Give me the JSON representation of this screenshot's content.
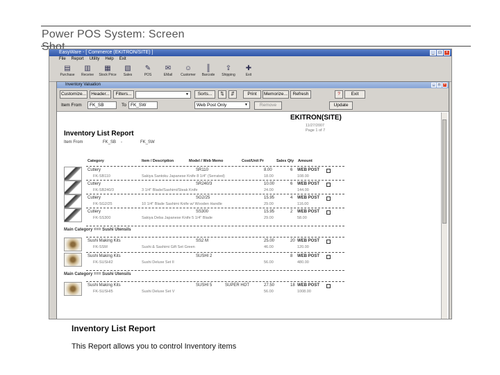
{
  "slide": {
    "title": "Power POS System: Screen Shot",
    "caption": "Inventory List Report",
    "description": "This Report allows you to control Inventory items"
  },
  "window": {
    "title": "EasyWare - [ Commerce (EKITRON/SITE) ]",
    "menu": [
      "File",
      "Report",
      "Utility",
      "Help",
      "Exit"
    ],
    "tools": [
      {
        "icon": "register-icon",
        "glyph": "▤",
        "label": "Purchase"
      },
      {
        "icon": "receive-icon",
        "glyph": "▥",
        "label": "Receive"
      },
      {
        "icon": "stock-icon",
        "glyph": "▦",
        "label": "Stock Price"
      },
      {
        "icon": "sales-icon",
        "glyph": "▧",
        "label": "Sales"
      },
      {
        "icon": "pos-icon",
        "glyph": "✎",
        "label": "POS"
      },
      {
        "icon": "email-icon",
        "glyph": "✉",
        "label": "EMail"
      },
      {
        "icon": "customer-icon",
        "glyph": "☺",
        "label": "Customer"
      },
      {
        "icon": "barcode-icon",
        "glyph": "║",
        "label": "Barcode"
      },
      {
        "icon": "shipping-icon",
        "glyph": "⇪",
        "label": "Shipping"
      },
      {
        "icon": "exit-icon",
        "glyph": "✚",
        "label": "Exit"
      }
    ]
  },
  "child": {
    "title": "Inventory Valuation",
    "buttons": {
      "customize": "Customize...",
      "header": "Header...",
      "filters": "Filters...",
      "sorts": "Sorts...",
      "print": "Print",
      "memorize": "Memorize...",
      "refresh": "Refresh",
      "exit": "Exit",
      "remove": "Remove",
      "update": "Update"
    },
    "item_from_label": "Item From",
    "item_from_value": "FK_SB",
    "to_label": "To",
    "to_value": "FK_SW",
    "web_filter": "Web Post Only"
  },
  "report": {
    "company": "EKITRON(SITE)",
    "date": "11/27/2007",
    "page": "Page 1 of 7",
    "title": "Inventory List Report",
    "range_label": "Item From",
    "range_from": "FK_SB",
    "range_sep": "-",
    "range_to": "FK_SW",
    "columns": [
      "Category",
      "Item / Description",
      "Model / Web Memo",
      "Cost/Unit Pr",
      "Sales Qty",
      "Amount"
    ],
    "rows": [
      {
        "category": "Cutlery",
        "item": "FK-SB110",
        "model": "SR110",
        "desc": "Sakiya Santoku Japanese Knife 8 1/4\" (Serrated)",
        "cost": "8.00",
        "price": "18.00",
        "qty": "6",
        "post": "WEB POST",
        "amount": "108.00"
      },
      {
        "category": "Cutlery",
        "item": "FK-SB240/3",
        "model": "SR240/3",
        "desc": "3 1/4\" Blade/Sashimi/Steak Knife",
        "cost": "10.00",
        "price": "24.00",
        "qty": "6",
        "post": "WEB POST",
        "amount": "144.00"
      },
      {
        "category": "Cutlery",
        "item": "FK-SG2/25",
        "model": "SG2/25",
        "desc": "10 1/4\" Blade Sashimi Knife w/ Wooden Handle",
        "cost": "15.95",
        "price": "29.00",
        "qty": "4",
        "post": "WEB POST",
        "amount": "116.00"
      },
      {
        "category": "Cutlery",
        "item": "FK-SS300",
        "model": "SS300",
        "desc": "Sakiya Deba Japanese Knife 5 1/4\" Blade",
        "cost": "15.95",
        "price": "29.00",
        "qty": "2",
        "post": "WEB POST",
        "amount": "58.00"
      }
    ],
    "main_category_1": "Main Category === Sushi Utensils",
    "rows2": [
      {
        "category": "Sushi Making Kits",
        "item": "FK-SSM",
        "model": "SS2 M",
        "desc": "Sushi & Sashimi Gift Set Green",
        "cost": "25.00",
        "price": "46.00",
        "qty": "20",
        "post": "WEB POST",
        "amount": "120.00"
      },
      {
        "category": "Sushi Making Kits",
        "item": "FK-SUSHI2",
        "model": "SUSHI 2",
        "desc": "Sushi Deluxe Set II",
        "cost": "",
        "price": "56.00",
        "qty": "8",
        "post": "WEB POST",
        "amount": "480.00"
      }
    ],
    "main_category_2": "Main Category === Sushi Utensils",
    "rows3": [
      {
        "category": "Sushi Making Kits",
        "item": "FK-SUSHI5",
        "model": "SUSHI 5",
        "memo": "SUPER HOT",
        "desc": "Sushi Deluxe Set V",
        "cost": "27.50",
        "price": "56.00",
        "qty": "18",
        "post": "WEB POST",
        "amount": "1008.00"
      }
    ]
  }
}
